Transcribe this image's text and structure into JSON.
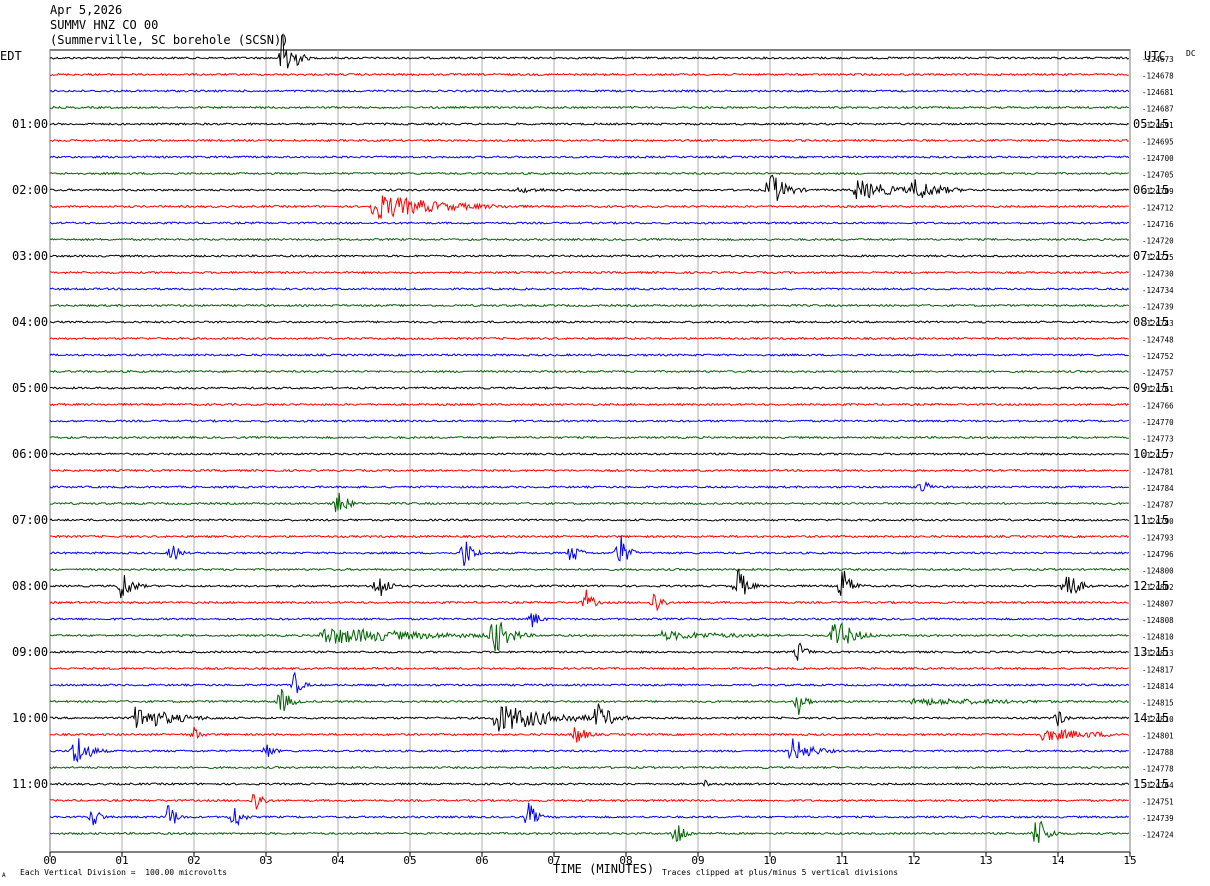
{
  "header": {
    "date": "Apr 5,2026",
    "channel": "SUMMV HNZ CO 00",
    "station": "(Summerville, SC borehole (SCSN))"
  },
  "left_tz": "EDT",
  "right_tz": "UTC",
  "dc_label": "DC",
  "footer": {
    "xlabel": "TIME (MINUTES)",
    "scale_note": "Each Vertical Division =  100.00 microvolts",
    "clip_note": "Traces clipped at plus/minus 5 vertical divisions",
    "corner_mark": "A"
  },
  "colors": [
    "#000000",
    "#ff0000",
    "#0000ff",
    "#006400"
  ],
  "chart_data": {
    "type": "line",
    "xlabel": "TIME (MINUTES)",
    "xlim": [
      0,
      15
    ],
    "x_ticks": [
      "00",
      "01",
      "02",
      "03",
      "04",
      "05",
      "06",
      "07",
      "08",
      "09",
      "10",
      "11",
      "12",
      "13",
      "14",
      "15"
    ],
    "left_hour_labels": [
      "01:00",
      "02:00",
      "03:00",
      "04:00",
      "05:00",
      "06:00",
      "07:00",
      "08:00",
      "09:00",
      "10:00",
      "11:00"
    ],
    "right_hour_labels": [
      "05:15",
      "06:15",
      "07:15",
      "08:15",
      "09:15",
      "10:15",
      "11:15",
      "12:15",
      "13:15",
      "14:15",
      "15:15"
    ],
    "trace_offsets": [
      -124673,
      -124678,
      -124681,
      -124687,
      -124691,
      -124695,
      -124700,
      -124705,
      -124709,
      -124712,
      -124716,
      -124720,
      -124725,
      -124730,
      -124734,
      -124739,
      -124743,
      -124748,
      -124752,
      -124757,
      -124761,
      -124766,
      -124770,
      -124773,
      -124777,
      -124781,
      -124784,
      -124787,
      -124790,
      -124793,
      -124796,
      -124800,
      -124802,
      -124807,
      -124808,
      -124810,
      -124813,
      -124817,
      -124814,
      -124815,
      -124810,
      -124801,
      -124788,
      -124778,
      -124764,
      -124751,
      -124739,
      -124724
    ],
    "events": [
      {
        "trace": 0,
        "minute": 3.25,
        "amplitude": 5,
        "duration": 0.35
      },
      {
        "trace": 8,
        "minute": 6.5,
        "amplitude": 0.4,
        "duration": 1.5
      },
      {
        "trace": 8,
        "minute": 10.0,
        "amplitude": 2.5,
        "duration": 0.6
      },
      {
        "trace": 8,
        "minute": 11.2,
        "amplitude": 1.4,
        "duration": 1.5
      },
      {
        "trace": 8,
        "minute": 12.0,
        "amplitude": 1.6,
        "duration": 1.0
      },
      {
        "trace": 9,
        "minute": 4.5,
        "amplitude": 1.8,
        "duration": 2.5
      },
      {
        "trace": 26,
        "minute": 12.1,
        "amplitude": 1.2,
        "duration": 0.3
      },
      {
        "trace": 27,
        "minute": 4.0,
        "amplitude": 2.0,
        "duration": 0.35
      },
      {
        "trace": 30,
        "minute": 1.7,
        "amplitude": 1.5,
        "duration": 0.3
      },
      {
        "trace": 30,
        "minute": 5.75,
        "amplitude": 2.2,
        "duration": 0.35
      },
      {
        "trace": 30,
        "minute": 7.25,
        "amplitude": 1.6,
        "duration": 0.3
      },
      {
        "trace": 30,
        "minute": 7.9,
        "amplitude": 3.0,
        "duration": 0.3
      },
      {
        "trace": 32,
        "minute": 1.0,
        "amplitude": 2.2,
        "duration": 0.4
      },
      {
        "trace": 32,
        "minute": 4.55,
        "amplitude": 2.4,
        "duration": 0.35
      },
      {
        "trace": 32,
        "minute": 9.55,
        "amplitude": 2.6,
        "duration": 0.35
      },
      {
        "trace": 32,
        "minute": 11.0,
        "amplitude": 2.6,
        "duration": 0.35
      },
      {
        "trace": 32,
        "minute": 14.1,
        "amplitude": 3.0,
        "duration": 0.4
      },
      {
        "trace": 33,
        "minute": 7.45,
        "amplitude": 1.6,
        "duration": 0.3
      },
      {
        "trace": 33,
        "minute": 8.4,
        "amplitude": 1.8,
        "duration": 0.3
      },
      {
        "trace": 34,
        "minute": 6.7,
        "amplitude": 1.3,
        "duration": 0.3
      },
      {
        "trace": 35,
        "minute": 3.8,
        "amplitude": 1.2,
        "duration": 4.0
      },
      {
        "trace": 35,
        "minute": 6.15,
        "amplitude": 3.0,
        "duration": 0.6
      },
      {
        "trace": 35,
        "minute": 10.9,
        "amplitude": 2.4,
        "duration": 0.7
      },
      {
        "trace": 35,
        "minute": 8.5,
        "amplitude": 0.6,
        "duration": 3.5
      },
      {
        "trace": 36,
        "minute": 10.4,
        "amplitude": 1.4,
        "duration": 0.3
      },
      {
        "trace": 38,
        "minute": 3.4,
        "amplitude": 1.6,
        "duration": 0.3
      },
      {
        "trace": 39,
        "minute": 3.2,
        "amplitude": 1.8,
        "duration": 0.4
      },
      {
        "trace": 39,
        "minute": 10.4,
        "amplitude": 1.8,
        "duration": 0.3
      },
      {
        "trace": 39,
        "minute": 12.0,
        "amplitude": 0.5,
        "duration": 5.0
      },
      {
        "trace": 40,
        "minute": 1.2,
        "amplitude": 1.8,
        "duration": 1.4
      },
      {
        "trace": 40,
        "minute": 6.2,
        "amplitude": 2.0,
        "duration": 2.2
      },
      {
        "trace": 40,
        "minute": 7.6,
        "amplitude": 2.0,
        "duration": 0.6
      },
      {
        "trace": 40,
        "minute": 14.0,
        "amplitude": 1.2,
        "duration": 0.3
      },
      {
        "trace": 41,
        "minute": 2.0,
        "amplitude": 1.0,
        "duration": 0.3
      },
      {
        "trace": 41,
        "minute": 7.3,
        "amplitude": 1.5,
        "duration": 0.4
      },
      {
        "trace": 41,
        "minute": 13.8,
        "amplitude": 0.9,
        "duration": 2.2
      },
      {
        "trace": 42,
        "minute": 0.35,
        "amplitude": 2.6,
        "duration": 0.5
      },
      {
        "trace": 42,
        "minute": 3.0,
        "amplitude": 1.2,
        "duration": 0.3
      },
      {
        "trace": 42,
        "minute": 10.3,
        "amplitude": 1.8,
        "duration": 0.8
      },
      {
        "trace": 44,
        "minute": 9.1,
        "amplitude": 0.5,
        "duration": 0.3
      },
      {
        "trace": 45,
        "minute": 2.85,
        "amplitude": 1.8,
        "duration": 0.3
      },
      {
        "trace": 46,
        "minute": 0.6,
        "amplitude": 1.5,
        "duration": 0.3
      },
      {
        "trace": 46,
        "minute": 1.65,
        "amplitude": 2.0,
        "duration": 0.3
      },
      {
        "trace": 46,
        "minute": 2.55,
        "amplitude": 2.0,
        "duration": 0.3
      },
      {
        "trace": 46,
        "minute": 6.65,
        "amplitude": 2.0,
        "duration": 0.3
      },
      {
        "trace": 47,
        "minute": 8.7,
        "amplitude": 2.2,
        "duration": 0.3
      },
      {
        "trace": 47,
        "minute": 13.7,
        "amplitude": 2.6,
        "duration": 0.4
      }
    ]
  }
}
